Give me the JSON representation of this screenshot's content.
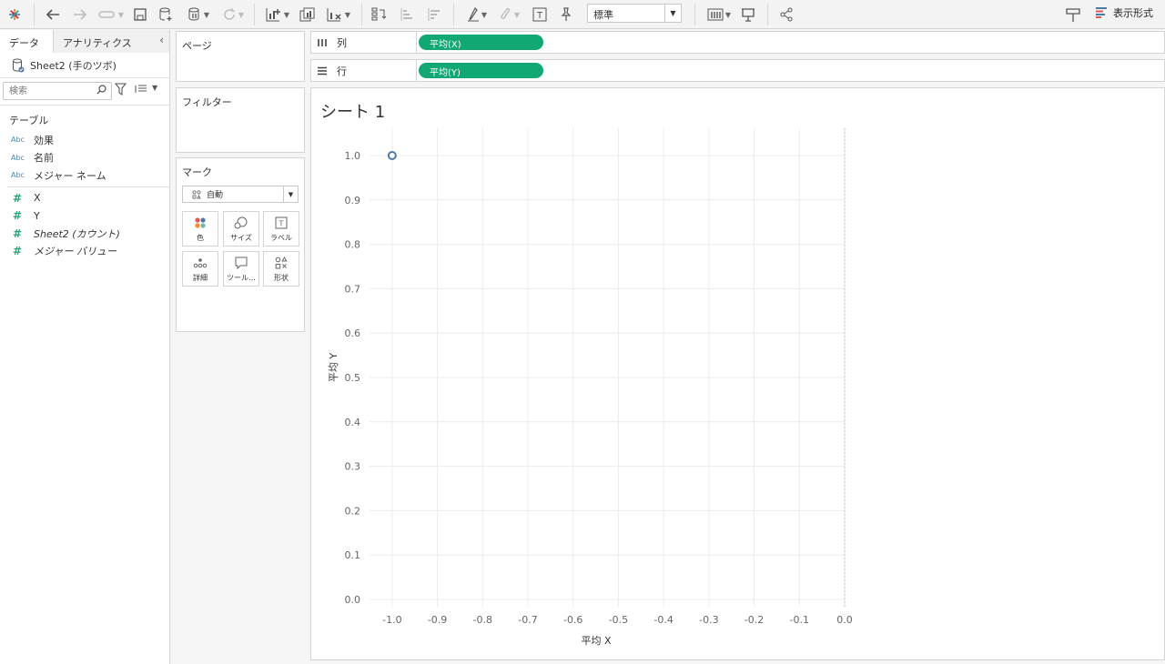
{
  "toolbar": {
    "format_select": "標準",
    "show_me": "表示形式"
  },
  "data_pane": {
    "tab_data": "データ",
    "tab_analytics": "アナリティクス",
    "datasource": "Sheet2 (手のツボ)",
    "search_placeholder": "検索",
    "tables_heading": "テーブル",
    "dimensions": [
      {
        "type": "Abc",
        "name": "効果"
      },
      {
        "type": "Abc",
        "name": "名前"
      },
      {
        "type": "Abc",
        "name": "メジャー ネーム"
      }
    ],
    "measures": [
      {
        "type": "#",
        "name": "X"
      },
      {
        "type": "#",
        "name": "Y"
      },
      {
        "type": "#",
        "name": "Sheet2 (カウント)"
      },
      {
        "type": "#",
        "name": "メジャー バリュー"
      }
    ]
  },
  "cards": {
    "pages": "ページ",
    "filters": "フィルター",
    "marks": "マーク",
    "mark_type": "自動",
    "buttons": [
      "色",
      "サイズ",
      "ラベル",
      "詳細",
      "ツール...",
      "形状"
    ]
  },
  "shelves": {
    "columns_label": "列",
    "columns_pill": "平均(X)",
    "rows_label": "行",
    "rows_pill": "平均(Y)"
  },
  "sheet_title": "シート 1",
  "chart_data": {
    "type": "scatter",
    "x": [
      -1.0
    ],
    "y": [
      1.0
    ],
    "xlabel": "平均 X",
    "ylabel": "平均 Y",
    "xlim": [
      -1.05,
      0.0
    ],
    "ylim": [
      0.0,
      1.0
    ],
    "xticks": [
      "-1.0",
      "-0.9",
      "-0.8",
      "-0.7",
      "-0.6",
      "-0.5",
      "-0.4",
      "-0.3",
      "-0.2",
      "-0.1",
      "0.0"
    ],
    "yticks": [
      "0.0",
      "0.1",
      "0.2",
      "0.3",
      "0.4",
      "0.5",
      "0.6",
      "0.7",
      "0.8",
      "0.9",
      "1.0"
    ],
    "grid": true,
    "marker": "hollow-circle",
    "color": "#4e79a7"
  }
}
